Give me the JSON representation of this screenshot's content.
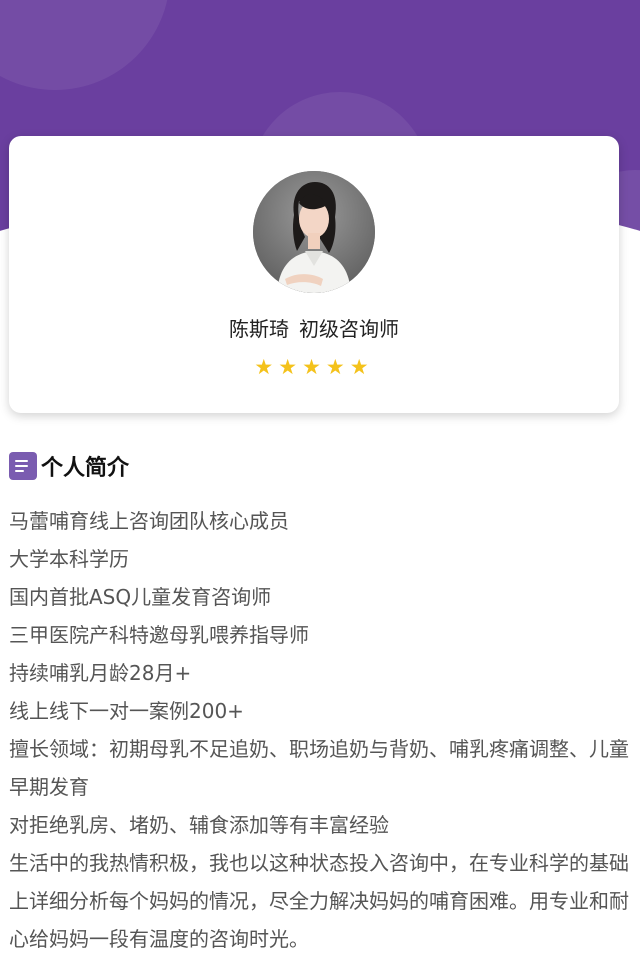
{
  "theme": {
    "header_bg": "#6a3f9f",
    "star_color": "#f4c21b",
    "icon_bg": "#7a5cb0"
  },
  "profile": {
    "name": "陈斯琦",
    "title": "初级咨询师",
    "rating": 5,
    "rating_max": 5
  },
  "section": {
    "icon": "document-list-icon",
    "title": "个人简介"
  },
  "bio": [
    "马蕾哺育线上咨询团队核心成员",
    "大学本科学历",
    "国内首批ASQ儿童发育咨询师",
    "三甲医院产科特邀母乳喂养指导师",
    "持续哺乳月龄28月+",
    "线上线下一对一案例200+",
    "擅长领域：初期母乳不足追奶、职场追奶与背奶、哺乳疼痛调整、儿童早期发育",
    "对拒绝乳房、堵奶、辅食添加等有丰富经验",
    "生活中的我热情积极，我也以这种状态投入咨询中，在专业科学的基础上详细分析每个妈妈的情况，尽全力解决妈妈的哺育困难。用专业和耐心给妈妈一段有温度的咨询时光。"
  ]
}
